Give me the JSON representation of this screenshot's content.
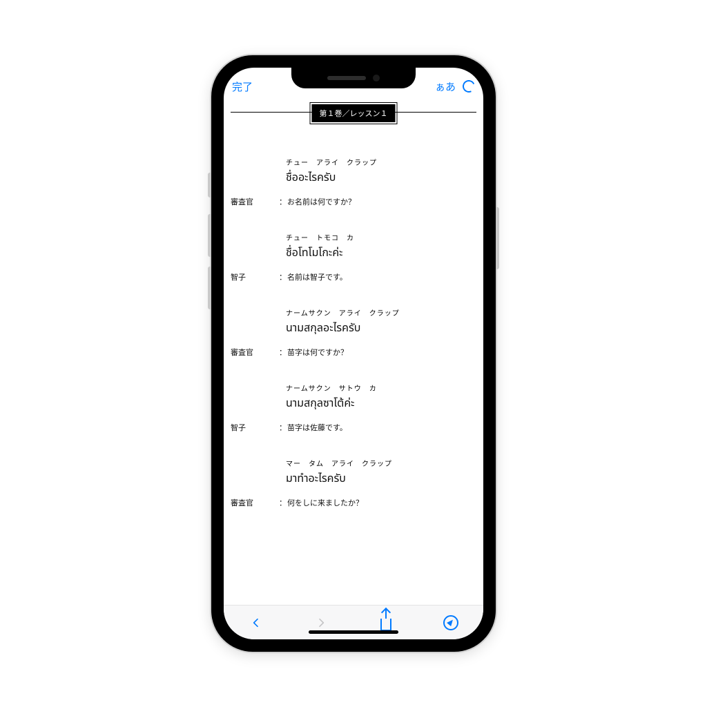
{
  "topbar": {
    "done_label": "完了",
    "text_size_label": "ぁあ"
  },
  "lesson_badge": "第１巻／レッスン１",
  "speakers": {
    "examiner": "審査官",
    "tomoko": "智子"
  },
  "entries": [
    {
      "kana": "チュー　アライ　クラップ",
      "thai": "ชื่ออะไรครับ",
      "speaker_key": "examiner",
      "jp": "お名前は何ですか？"
    },
    {
      "kana": "チュー　トモコ　カ",
      "thai": "ชื่อโทโมโกะค่ะ",
      "speaker_key": "tomoko",
      "jp": "名前は智子です。"
    },
    {
      "kana": "ナームサクン　アライ　クラップ",
      "thai": "นามสกุลอะไรครับ",
      "speaker_key": "examiner",
      "jp": "苗字は何ですか？"
    },
    {
      "kana": "ナームサクン　サトウ　カ",
      "thai": "นามสกุลซาโต้ค่ะ",
      "speaker_key": "tomoko",
      "jp": "苗字は佐藤です。"
    },
    {
      "kana": "マー　タム　アライ　クラップ",
      "thai": "มาทำอะไรครับ",
      "speaker_key": "examiner",
      "jp": "何をしに来ましたか？"
    }
  ],
  "colon": "："
}
